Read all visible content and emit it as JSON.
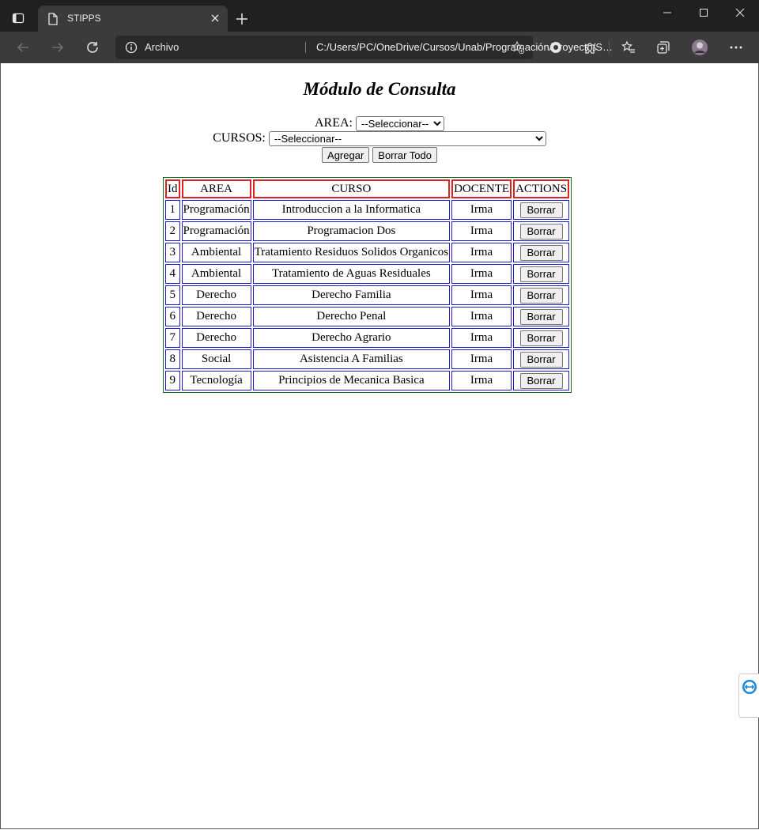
{
  "browser": {
    "tab_title": "STIPPS",
    "site_label": "Archivo",
    "url": "C:/Users/PC/OneDrive/Cursos/Unab/Programación/Proyecto/STIPPS/index.html"
  },
  "page": {
    "title": "Módulo de Consulta",
    "area_label": "AREA:",
    "area_selected": "--Seleccionar--",
    "cursos_label": "CURSOS:",
    "cursos_selected": "--Seleccionar--",
    "add_label": "Agregar",
    "clear_label": "Borrar Todo"
  },
  "table": {
    "headers": [
      "Id",
      "AREA",
      "CURSO",
      "DOCENTE",
      "ACTIONS"
    ],
    "action_label": "Borrar",
    "rows": [
      {
        "id": "1",
        "area": "Programación",
        "curso": "Introduccion a la Informatica",
        "docente": "Irma"
      },
      {
        "id": "2",
        "area": "Programación",
        "curso": "Programacion Dos",
        "docente": "Irma"
      },
      {
        "id": "3",
        "area": "Ambiental",
        "curso": "Tratamiento Residuos Solidos Organicos",
        "docente": "Irma"
      },
      {
        "id": "4",
        "area": "Ambiental",
        "curso": "Tratamiento de Aguas Residuales",
        "docente": "Irma"
      },
      {
        "id": "5",
        "area": "Derecho",
        "curso": "Derecho Familia",
        "docente": "Irma"
      },
      {
        "id": "6",
        "area": "Derecho",
        "curso": "Derecho Penal",
        "docente": "Irma"
      },
      {
        "id": "7",
        "area": "Derecho",
        "curso": "Derecho Agrario",
        "docente": "Irma"
      },
      {
        "id": "8",
        "area": "Social",
        "curso": "Asistencia A Familias",
        "docente": "Irma"
      },
      {
        "id": "9",
        "area": "Tecnología",
        "curso": "Principios de Mecanica Basica",
        "docente": "Irma"
      }
    ]
  },
  "icons": {
    "tab_actions": "tab-actions-icon",
    "favicon": "document-icon",
    "tab_close": "close-icon",
    "new_tab": "plus-icon",
    "minimize": "minimize-icon",
    "maximize": "maximize-icon",
    "window_close": "window-close-icon",
    "back": "back-arrow-icon",
    "forward": "forward-arrow-icon",
    "reload": "reload-icon",
    "site_info": "info-icon",
    "add_favorite": "add-favorite-icon",
    "tracking": "tracking-icon",
    "extensions": "puzzle-icon",
    "favorites": "favorites-icon",
    "collections": "collections-icon",
    "profile": "avatar",
    "more": "more-icon",
    "teamviewer": "teamviewer-icon"
  },
  "colors": {
    "header_border": "#dd2222",
    "cell_border": "#1b1bd0",
    "table_border": "#0a6b2a",
    "titlebar": "#202020",
    "toolbar": "#3b3b3b"
  }
}
